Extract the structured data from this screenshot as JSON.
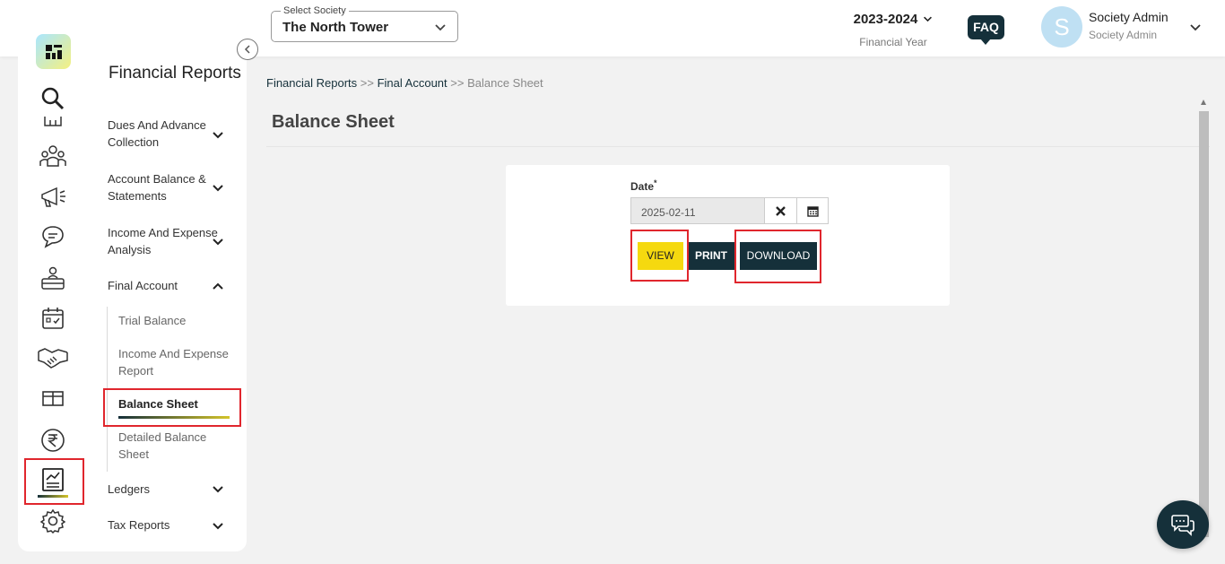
{
  "header": {
    "society_label": "Select Society",
    "society_value": "The North Tower",
    "financial_year": "2023-2024",
    "financial_year_label": "Financial Year",
    "faq_label": "FAQ",
    "avatar_letter": "S",
    "user_name": "Society Admin",
    "user_role": "Society Admin"
  },
  "sidebar": {
    "title": "Financial Reports",
    "menu": [
      {
        "label": "Dues And Advance Collection",
        "expanded": false
      },
      {
        "label": "Account Balance & Statements",
        "expanded": false
      },
      {
        "label": "Income And Expense Analysis",
        "expanded": false
      },
      {
        "label": "Final Account",
        "expanded": true
      },
      {
        "label": "Ledgers",
        "expanded": false
      },
      {
        "label": "Tax Reports",
        "expanded": false
      }
    ],
    "final_account_items": [
      {
        "label": "Trial Balance"
      },
      {
        "label": "Income And Expense Report"
      },
      {
        "label": "Balance Sheet",
        "active": true
      },
      {
        "label": "Detailed Balance Sheet"
      }
    ],
    "rail_icons": [
      "search-icon",
      "building-icon",
      "members-icon",
      "megaphone-icon",
      "chat-icon",
      "helpdesk-icon",
      "calendar-icon",
      "handshake-icon",
      "amenity-icon",
      "rupee-icon",
      "reports-icon",
      "settings-icon"
    ]
  },
  "main": {
    "breadcrumb": {
      "item1": "Financial Reports",
      "sep": ">>",
      "item2": "Final Account",
      "current": "Balance Sheet"
    },
    "page_title": "Balance Sheet",
    "date_label": "Date",
    "required_mark": "*",
    "date_value": "2025-02-11",
    "buttons": {
      "view": "VIEW",
      "print": "PRINT",
      "download": "DOWNLOAD"
    }
  },
  "colors": {
    "primary_dark": "#15303a",
    "accent_yellow": "#f5d90f",
    "highlight_red": "#e0262d"
  }
}
